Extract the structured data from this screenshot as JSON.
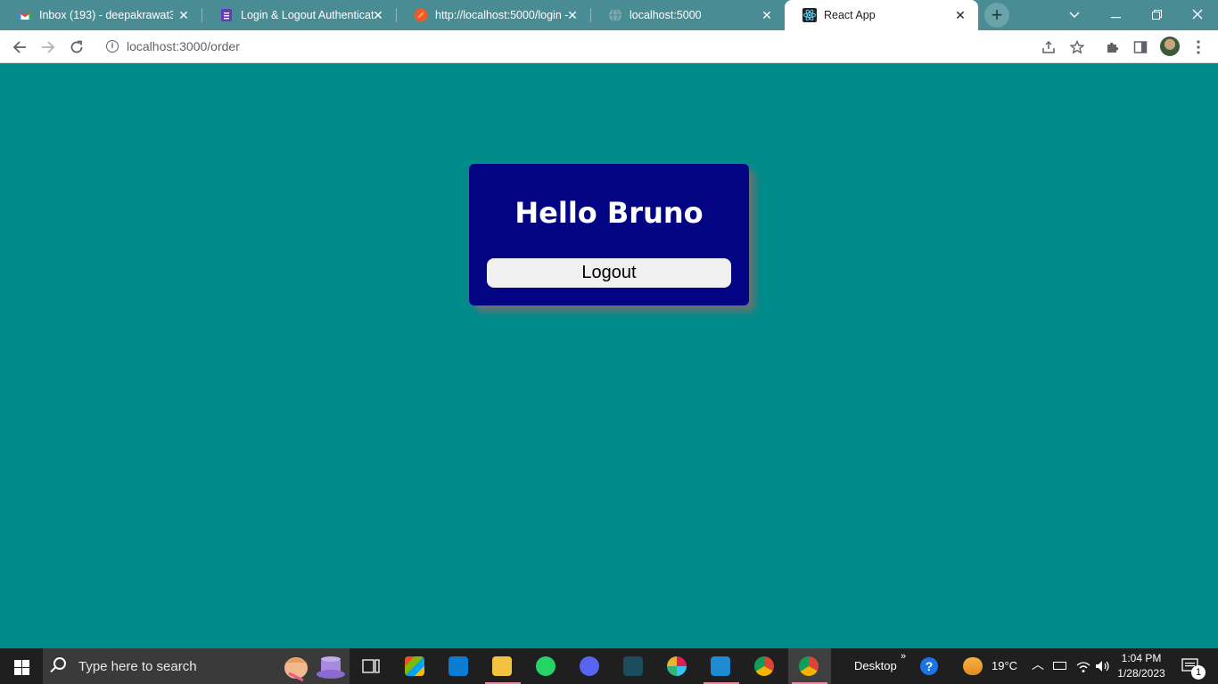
{
  "browser": {
    "tabs": [
      {
        "title": "Inbox (193) - deepakrawat37",
        "icon": "gmail-icon"
      },
      {
        "title": "Login & Logout Authenticatio",
        "icon": "forms-icon"
      },
      {
        "title": "http://localhost:5000/login -",
        "icon": "postman-icon"
      },
      {
        "title": "localhost:5000",
        "icon": "globe-icon"
      },
      {
        "title": "React App",
        "icon": "react-icon",
        "active": true
      }
    ],
    "address": "localhost:3000/order"
  },
  "page": {
    "greeting": "Hello Bruno",
    "logout_label": "Logout",
    "background_color": "#008b8b",
    "card_color": "#030483"
  },
  "taskbar": {
    "search_placeholder": "Type here to search",
    "desktop_label": "Desktop",
    "temperature": "19°C",
    "time": "1:04 PM",
    "date": "1/28/2023",
    "notification_count": "1"
  }
}
